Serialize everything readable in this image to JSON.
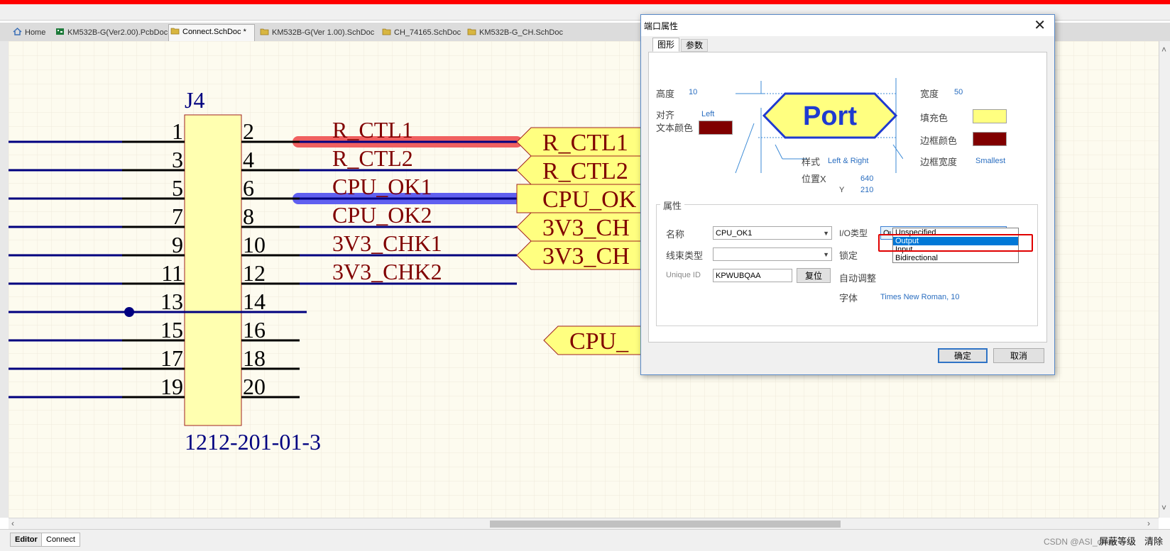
{
  "tabs": [
    {
      "label": "Home",
      "icon": "home-icon",
      "color": "#3b6fb6"
    },
    {
      "label": "KM532B-G(Ver2.00).PcbDoc",
      "icon": "pcb-doc-icon",
      "color": "#1d7a3a"
    },
    {
      "label": "Connect.SchDoc *",
      "icon": "sch-doc-icon",
      "color": "#d8b640",
      "active": true
    },
    {
      "label": "KM532B-G(Ver 1.00).SchDoc",
      "icon": "sch-doc-icon",
      "color": "#d8b640"
    },
    {
      "label": "CH_74165.SchDoc",
      "icon": "sch-doc-icon",
      "color": "#d8b640"
    },
    {
      "label": "KM532B-G_CH.SchDoc",
      "icon": "sch-doc-icon",
      "color": "#d8b640"
    }
  ],
  "schematic": {
    "designator": "J4",
    "part_number": "1212-201-01-3",
    "left_pins": [
      "1",
      "3",
      "5",
      "7",
      "9",
      "11",
      "13",
      "15",
      "17",
      "19"
    ],
    "right_pins": [
      "2",
      "4",
      "6",
      "8",
      "10",
      "12",
      "14",
      "16",
      "18",
      "20"
    ],
    "net_labels": [
      "R_CTL1",
      "R_CTL2",
      "CPU_OK1",
      "CPU_OK2",
      "3V3_CHK1",
      "3V3_CHK2"
    ],
    "ports": [
      "R_CTL1",
      "R_CTL2",
      "CPU_OK",
      "3V3_CH",
      "3V3_CH"
    ],
    "lower_port": "CPU_",
    "colors": {
      "wire": "#000080",
      "pin": "#000000",
      "text": "#800000",
      "port_fill": "#ffff80",
      "body_fill": "#ffffb0",
      "highlight_red": "#f06060",
      "highlight_blue": "#6060f0"
    }
  },
  "dialog": {
    "title": "端口属性",
    "close": "✕",
    "tabs": [
      "图形",
      "参数"
    ],
    "graphic": {
      "height_label": "高度",
      "height_value": "10",
      "width_label": "宽度",
      "width_value": "50",
      "align_label": "对齐",
      "align_value": "Left",
      "text_color_label": "文本颜色",
      "text_color": "#800000",
      "fill_label": "填充色",
      "fill_color": "#ffff80",
      "border_color_label": "边框颜色",
      "border_color": "#800000",
      "style_label": "样式",
      "style_value": "Left & Right",
      "border_width_label": "边框宽度",
      "border_width_value": "Smallest",
      "posx_label": "位置X",
      "posx_value": "640",
      "posy_label": "Y",
      "posy_value": "210",
      "preview_text": "Port"
    },
    "props": {
      "group_label": "属性",
      "name_label": "名称",
      "name_value": "CPU_OK1",
      "harness_label": "线束类型",
      "harness_value": "",
      "uid_label": "Unique ID",
      "uid_value": "KPWUBQAA",
      "reset_label": "复位",
      "io_label": "I/O类型",
      "io_value": "Output",
      "io_options": [
        "Unspecified",
        "Output",
        "Input",
        "Bidirectional"
      ],
      "lock_label": "锁定",
      "autosize_label": "自动调整",
      "font_label": "字体",
      "font_value": "Times New Roman, 10"
    },
    "ok_label": "确定",
    "cancel_label": "取消"
  },
  "status": {
    "editor_tab": "Editor",
    "connect_tab": "Connect",
    "mask_level": "屏蔽等级",
    "clear": "清除",
    "watermark": "CSDN @ASI_chen"
  }
}
